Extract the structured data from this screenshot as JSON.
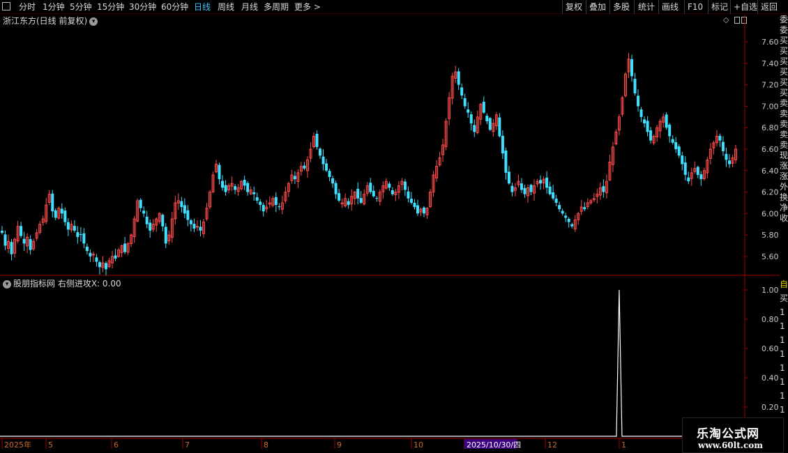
{
  "toolbar": {
    "left_items": [
      {
        "label": "分时",
        "active": false
      },
      {
        "label": "1分钟",
        "active": false
      },
      {
        "label": "5分钟",
        "active": false
      },
      {
        "label": "15分钟",
        "active": false
      },
      {
        "label": "30分钟",
        "active": false
      },
      {
        "label": "60分钟",
        "active": false
      },
      {
        "label": "日线",
        "active": true
      },
      {
        "label": "周线",
        "active": false
      },
      {
        "label": "月线",
        "active": false
      },
      {
        "label": "多周期",
        "active": false
      },
      {
        "label": "更多 >",
        "active": false
      }
    ],
    "right_items": [
      "复权",
      "叠加",
      "多股",
      "统计",
      "画线",
      "F10",
      "标记",
      "+自选",
      "返回"
    ]
  },
  "stock_title": "浙江东方(日线 前复权)",
  "indicator_title": "股朋指标网 右侧进攻X: 0.00",
  "right_strip_main": [
    "委",
    "委",
    "买",
    "买",
    "买",
    "买",
    "买",
    "买",
    "卖",
    "卖",
    "卖",
    "卖",
    "卖",
    "现",
    "涨",
    "涨",
    "外",
    "换",
    "净",
    "收"
  ],
  "right_strip_indicator": [
    "自",
    "买",
    "1",
    "1",
    "1",
    "1",
    "1",
    "1",
    "1",
    "1"
  ],
  "x_axis": {
    "labels": [
      "2025年",
      "5",
      "6",
      "7",
      "8",
      "9",
      "10",
      "2025/10/30/四",
      "12",
      "1"
    ],
    "highlight_label": "2025/10/30/四"
  },
  "watermark": {
    "line1": "乐淘公式网",
    "line2": "www.60lt.com"
  },
  "colors": {
    "up": "#ff4b4b",
    "down": "#3fe0ff",
    "axis": "#9e0000",
    "grid": "#3a0000",
    "label": "#c8c8c8",
    "highlight_bg": "#3a0080",
    "indicator_line": "#ffffff"
  },
  "chart_data": [
    {
      "type": "candlestick",
      "title": "浙江东方(日线 前复权)",
      "ylim": [
        5.45,
        7.75
      ],
      "yticks": [
        "7.60",
        "7.40",
        "7.20",
        "7.00",
        "6.80",
        "6.60",
        "6.40",
        "6.20",
        "6.00",
        "5.80",
        "5.60"
      ],
      "close_path": [
        5.82,
        5.7,
        5.74,
        5.62,
        5.76,
        5.88,
        5.79,
        5.72,
        5.78,
        5.66,
        5.74,
        5.82,
        5.9,
        5.95,
        6.08,
        6.18,
        6.02,
        5.96,
        6.05,
        6.0,
        5.92,
        5.85,
        5.9,
        5.84,
        5.78,
        5.8,
        5.72,
        5.65,
        5.6,
        5.62,
        5.55,
        5.5,
        5.54,
        5.48,
        5.56,
        5.6,
        5.58,
        5.66,
        5.7,
        5.64,
        5.72,
        5.8,
        5.95,
        6.12,
        6.05,
        6.0,
        5.9,
        5.84,
        5.9,
        5.95,
        6.0,
        5.88,
        5.72,
        5.8,
        5.95,
        6.1,
        6.12,
        6.06,
        6.0,
        5.94,
        5.9,
        5.86,
        5.88,
        5.84,
        5.92,
        6.05,
        6.2,
        6.36,
        6.46,
        6.32,
        6.24,
        6.2,
        6.26,
        6.28,
        6.22,
        6.24,
        6.3,
        6.26,
        6.2,
        6.22,
        6.18,
        6.12,
        6.08,
        6.02,
        6.06,
        6.1,
        6.14,
        6.08,
        6.06,
        6.1,
        6.2,
        6.28,
        6.36,
        6.32,
        6.38,
        6.44,
        6.42,
        6.5,
        6.6,
        6.72,
        6.62,
        6.54,
        6.46,
        6.4,
        6.34,
        6.28,
        6.18,
        6.12,
        6.1,
        6.14,
        6.08,
        6.16,
        6.2,
        6.14,
        6.1,
        6.18,
        6.26,
        6.2,
        6.16,
        6.14,
        6.2,
        6.26,
        6.3,
        6.24,
        6.18,
        6.2,
        6.26,
        6.3,
        6.22,
        6.14,
        6.1,
        6.06,
        6.0,
        6.04,
        6.0,
        6.05,
        6.2,
        6.36,
        6.44,
        6.52,
        6.64,
        6.86,
        7.08,
        7.28,
        7.32,
        7.2,
        7.1,
        7.0,
        6.94,
        6.84,
        6.76,
        6.9,
        7.02,
        6.94,
        6.86,
        6.78,
        6.84,
        6.92,
        6.72,
        6.56,
        6.38,
        6.28,
        6.2,
        6.24,
        6.3,
        6.22,
        6.18,
        6.24,
        6.2,
        6.26,
        6.3,
        6.28,
        6.32,
        6.24,
        6.18,
        6.14,
        6.1,
        6.04,
        6.0,
        5.96,
        5.92,
        5.88,
        5.94,
        6.0,
        6.06,
        6.04,
        6.1,
        6.12,
        6.14,
        6.18,
        6.24,
        6.2,
        6.3,
        6.48,
        6.62,
        6.76,
        6.9,
        7.08,
        7.3,
        7.44,
        7.28,
        7.12,
        7.0,
        6.9,
        6.84,
        6.76,
        6.68,
        6.72,
        6.8,
        6.86,
        6.9,
        6.8,
        6.72,
        6.66,
        6.6,
        6.54,
        6.46,
        6.36,
        6.3,
        6.38,
        6.42,
        6.36,
        6.32,
        6.4,
        6.5,
        6.6,
        6.66,
        6.72,
        6.68,
        6.58,
        6.5,
        6.46,
        6.52,
        6.6
      ]
    },
    {
      "type": "line",
      "title": "股朋指标网 右侧进攻X: 0.00",
      "ylim": [
        0,
        1.05
      ],
      "yticks": [
        "1.00",
        "0.80",
        "0.60",
        "0.40",
        "0.20"
      ],
      "baseline": 0,
      "spike_index": 196,
      "spike_value": 1.0
    }
  ]
}
